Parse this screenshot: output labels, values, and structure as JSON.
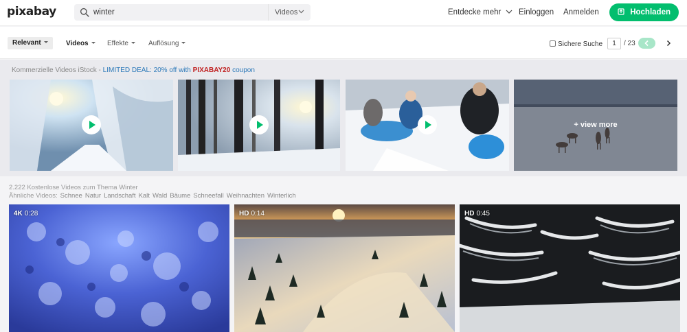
{
  "header": {
    "logo": "pixabay",
    "search": {
      "value": "winter",
      "type": "Videos"
    },
    "nav": {
      "discover": "Entdecke mehr",
      "login": "Einloggen",
      "signup": "Anmelden",
      "upload": "Hochladen"
    }
  },
  "filters": {
    "relevant": "Relevant",
    "videos": "Videos",
    "effects": "Effekte",
    "resolution": "Auflösung",
    "safe_search": "Sichere Suche",
    "page": "1",
    "page_total": "/ 23"
  },
  "promo": {
    "label": "Kommerzielle Videos iStock - ",
    "deal": "LIMITED DEAL: 20% off with ",
    "code": "PIXABAY20",
    "coupon": " coupon",
    "view_more": "+ view more"
  },
  "results": {
    "count": "2.222 Kostenlose Videos zum Thema Winter",
    "related_label": "Ähnliche Videos:",
    "related_tags": [
      "Schnee",
      "Natur",
      "Landschaft",
      "Kalt",
      "Wald",
      "Bäume",
      "Schneefall",
      "Weihnachten",
      "Winterlich"
    ],
    "videos": [
      {
        "quality": "4K",
        "duration": "0:28"
      },
      {
        "quality": "HD",
        "duration": "0:14"
      },
      {
        "quality": "HD",
        "duration": "0:45"
      }
    ]
  },
  "colors": {
    "accent": "#02be6e",
    "deal": "#2b78b8",
    "code": "#c02020"
  }
}
